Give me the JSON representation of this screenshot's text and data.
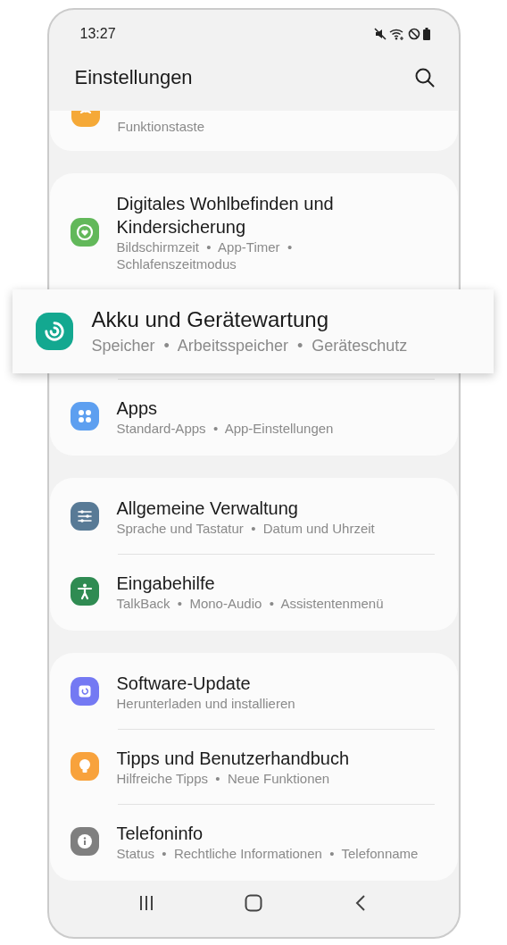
{
  "status_bar": {
    "time": "13:27"
  },
  "header": {
    "title": "Einstellungen"
  },
  "groups": [
    {
      "items": [
        {
          "subtitle": "Funktionstaste",
          "color": "#f5a937"
        }
      ]
    },
    {
      "items": [
        {
          "title": "Digitales Wohlbefinden und Kindersicherung",
          "subtitle": "Bildschirmzeit  •  App-Timer  •\nSchlafenszeitmodus",
          "color": "#62b85a",
          "kind": "row"
        },
        {
          "title": "Akku und Gerätewartung",
          "subtitle": "Speicher  •  Arbeitsspeicher  •  Geräteschutz",
          "color": "#13a890",
          "kind": "popup"
        },
        {
          "title": "Apps",
          "subtitle": "Standard-Apps  •  App-Einstellungen",
          "color": "#5d9ff0",
          "kind": "row"
        }
      ]
    },
    {
      "items": [
        {
          "title": "Allgemeine Verwaltung",
          "subtitle": "Sprache und Tastatur  •  Datum und Uhrzeit",
          "color": "#587a96",
          "kind": "row"
        },
        {
          "title": "Eingabehilfe",
          "subtitle": "TalkBack  •  Mono-Audio  •  Assistentenmenü",
          "color": "#2f8b52",
          "kind": "row"
        }
      ]
    },
    {
      "items": [
        {
          "title": "Software-Update",
          "subtitle": "Herunterladen und installieren",
          "color": "#7479f3",
          "kind": "row"
        },
        {
          "title": "Tipps und Benutzerhandbuch",
          "subtitle": "Hilfreiche Tipps  •  Neue Funktionen",
          "color": "#f8a23c",
          "kind": "row"
        },
        {
          "title": "Telefoninfo",
          "subtitle": "Status  •  Rechtliche Informationen  •  Telefonname",
          "color": "#7f7f7f",
          "kind": "row"
        }
      ]
    }
  ]
}
